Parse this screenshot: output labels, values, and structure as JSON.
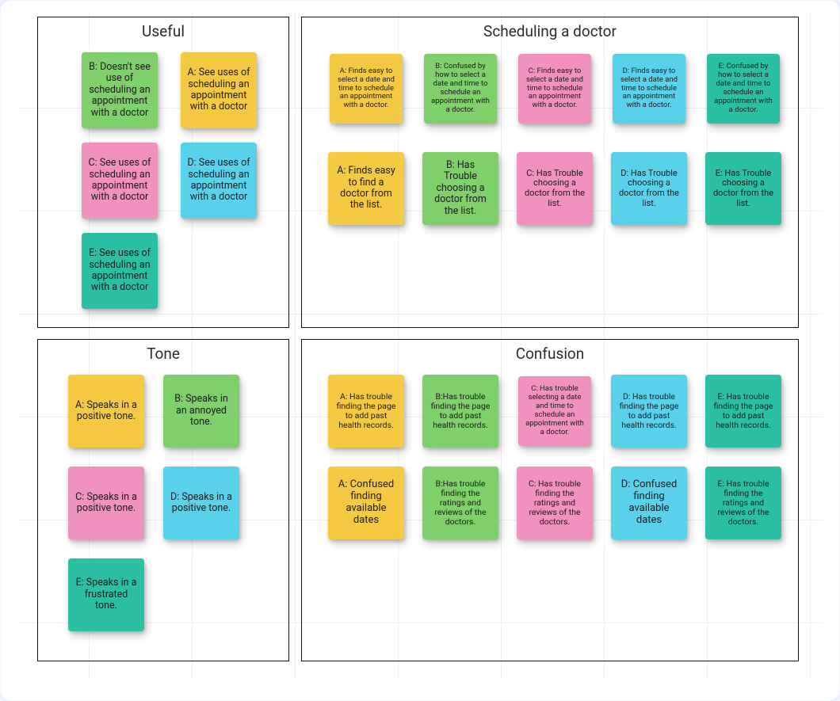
{
  "groups": {
    "useful": {
      "title": "Useful"
    },
    "scheduling": {
      "title": "Scheduling a doctor"
    },
    "tone": {
      "title": "Tone"
    },
    "confusion": {
      "title": "Confusion"
    }
  },
  "notes": {
    "useful": {
      "b": "B: Doesn't see use of scheduling an appointment with a doctor",
      "a": "A: See uses of scheduling an appointment with a doctor",
      "c": "C: See uses of scheduling an appointment with a doctor",
      "d": "D: See uses of scheduling an appointment with a doctor",
      "e": "E: See uses of scheduling an appointment with a doctor"
    },
    "scheduling": {
      "row1": {
        "a": "A: Finds easy to select a date and time to schedule an appointment with a doctor.",
        "b": "B: Confused by how to select a date and time to schedule an appointment with a doctor.",
        "c": "C: Finds easy to select a date and time to schedule an appointment with a doctor.",
        "d": "D: Finds easy to select a date and time to schedule an appointment with a doctor.",
        "e": "E: Confused by how to select a date and time to schedule an appointment with a doctor."
      },
      "row2": {
        "a": "A: Finds easy to find a doctor from the list.",
        "b": "B: Has Trouble choosing a doctor from the list.",
        "c": "C: Has Trouble choosing a doctor from the list.",
        "d": "D: Has Trouble choosing a doctor from the list.",
        "e": "E: Has Trouble choosing a doctor from the list."
      }
    },
    "tone": {
      "a": "A: Speaks in a positive tone.",
      "b": "B: Speaks in an annoyed tone.",
      "c": "C: Speaks in a positive tone.",
      "d": "D: Speaks in a positive tone.",
      "e": "E: Speaks in a frustrated tone."
    },
    "confusion": {
      "row1": {
        "a": "A: Has trouble finding the page to add past health records.",
        "b": "B:Has trouble finding the page to add past health records.",
        "c": "C: Has trouble selecting a date and time to schedule an appointment with a doctor.",
        "d": "D: Has trouble finding the page to add past health records.",
        "e": "E: Has trouble finding the page to add past health records."
      },
      "row2": {
        "a": "A: Confused finding available dates",
        "b": "B:Has trouble finding the ratings and reviews of the doctors.",
        "c": "C: Has trouble finding the ratings and reviews of the doctors.",
        "d": "D: Confused finding available dates",
        "e": "E: Has trouble finding the ratings and reviews of the doctors."
      }
    }
  },
  "colors": {
    "yellow": "#f5c942",
    "green": "#7fcf6b",
    "pink": "#f191c0",
    "blue": "#5ad1ea",
    "teal": "#2bbfa3"
  }
}
